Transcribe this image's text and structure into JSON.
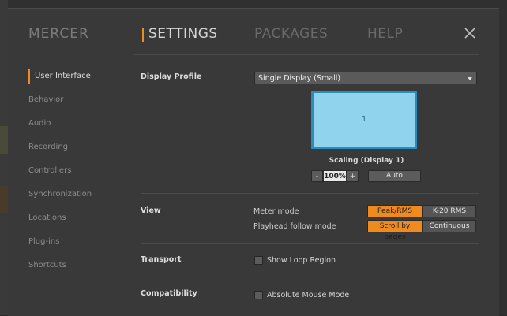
{
  "app": {
    "name": "MERCER"
  },
  "tabs": [
    {
      "label": "SETTINGS",
      "active": true
    },
    {
      "label": "PACKAGES",
      "active": false
    },
    {
      "label": "HELP",
      "active": false
    }
  ],
  "sidebar": {
    "items": [
      {
        "label": "User Interface",
        "active": true
      },
      {
        "label": "Behavior"
      },
      {
        "label": "Audio"
      },
      {
        "label": "Recording"
      },
      {
        "label": "Controllers"
      },
      {
        "label": "Synchronization"
      },
      {
        "label": "Locations"
      },
      {
        "label": "Plug-ins"
      },
      {
        "label": "Shortcuts"
      }
    ]
  },
  "display": {
    "section_label": "Display Profile",
    "profile_value": "Single Display (Small)",
    "monitor_number": "1",
    "scaling_label": "Scaling (Display 1)",
    "scale_minus": "-",
    "scale_value": "100%",
    "scale_plus": "+",
    "auto_label": "Auto"
  },
  "view": {
    "section_label": "View",
    "meter_mode_label": "Meter mode",
    "meter_options": [
      "Peak/RMS",
      "K-20 RMS"
    ],
    "meter_selected": "Peak/RMS",
    "playhead_label": "Playhead follow mode",
    "playhead_options": [
      "Scroll by pages",
      "Continuous"
    ],
    "playhead_selected": "Scroll by pages"
  },
  "transport": {
    "section_label": "Transport",
    "show_loop_label": "Show Loop Region",
    "show_loop_checked": false
  },
  "compatibility": {
    "section_label": "Compatibility",
    "absolute_mouse_label": "Absolute Mouse Mode",
    "absolute_mouse_checked": false
  },
  "colors": {
    "accent": "#f08a24",
    "dialog_bg": "#393939",
    "monitor_fill": "#8fd4ec",
    "monitor_border": "#2a8dbd"
  }
}
